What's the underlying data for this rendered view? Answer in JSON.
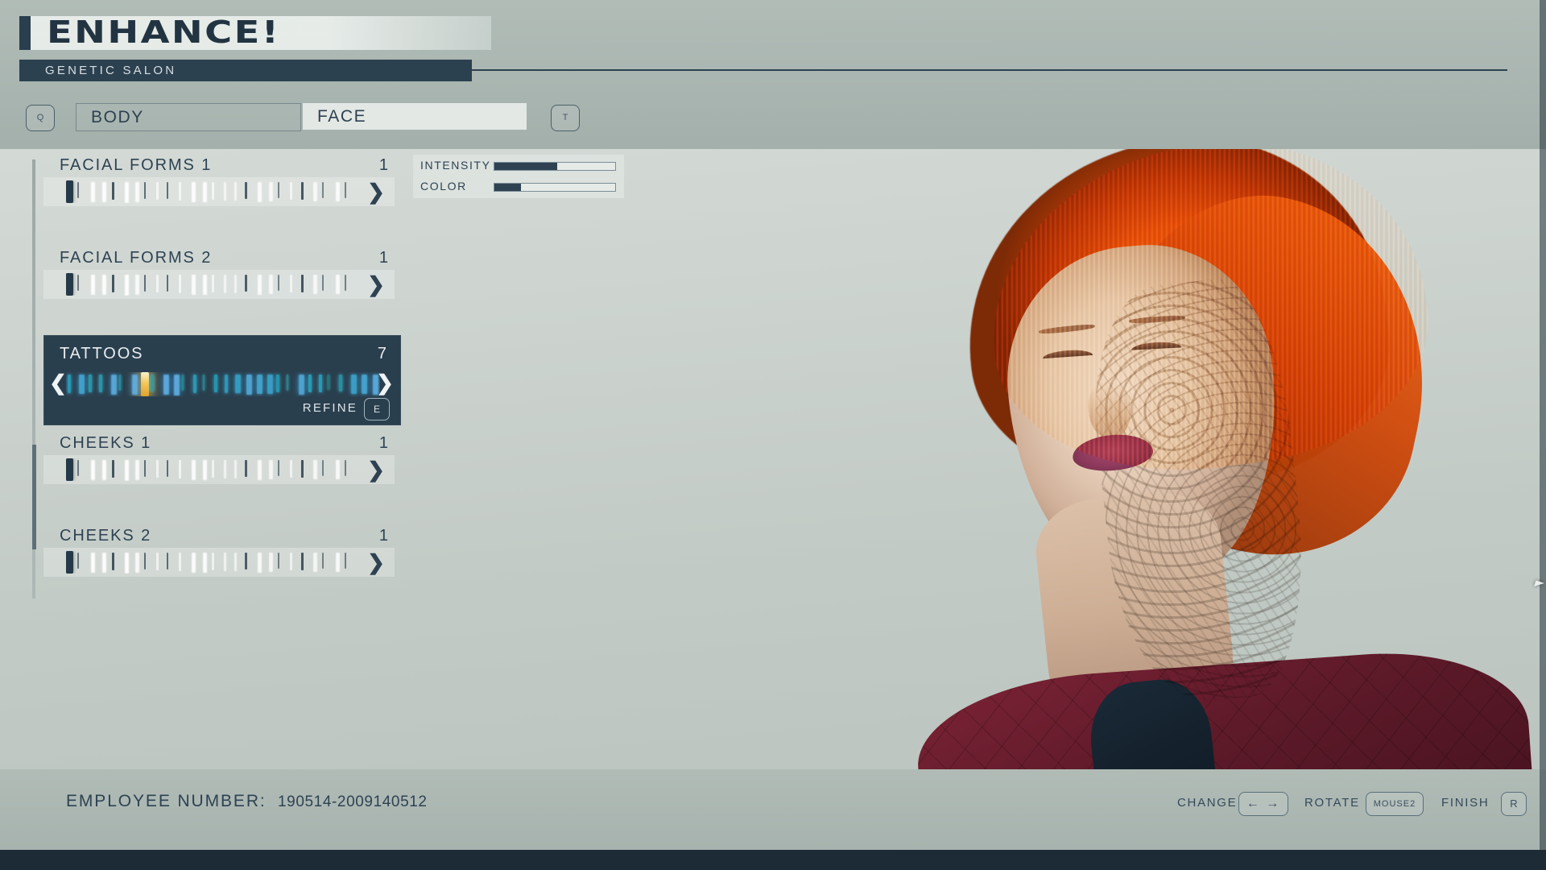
{
  "header": {
    "logo_text": "ENHANCE!",
    "subtitle": "GENETIC SALON",
    "key_left": "Q",
    "key_right": "T",
    "tabs": [
      {
        "label": "BODY",
        "selected": false
      },
      {
        "label": "FACE",
        "selected": true
      }
    ]
  },
  "options": [
    {
      "label": "FACIAL FORMS 1",
      "value": "1",
      "selected": false,
      "tick_count": 26,
      "selected_index": 0
    },
    {
      "label": "FACIAL FORMS 2",
      "value": "1",
      "selected": false,
      "tick_count": 26,
      "selected_index": 0
    },
    {
      "label": "TATTOOS",
      "value": "7",
      "selected": true,
      "tick_count": 30,
      "selected_index": 7,
      "refine_label": "REFINE",
      "refine_key": "E"
    },
    {
      "label": "CHEEKS 1",
      "value": "1",
      "selected": false,
      "tick_count": 26,
      "selected_index": 0
    },
    {
      "label": "CHEEKS 2",
      "value": "1",
      "selected": false,
      "tick_count": 26,
      "selected_index": 0
    }
  ],
  "sliders": [
    {
      "label": "INTENSITY",
      "fill_percent": 52
    },
    {
      "label": "COLOR",
      "fill_percent": 22
    }
  ],
  "footer": {
    "employee_label": "EMPLOYEE NUMBER:",
    "employee_value": "190514-2009140512",
    "controls": [
      {
        "label": "CHANGE",
        "key": "←  →"
      },
      {
        "label": "ROTATE",
        "key": "MOUSE2"
      },
      {
        "label": "FINISH",
        "key": "R"
      }
    ]
  },
  "colors": {
    "accent_dark": "#2a3f4e",
    "panel_light": "#b0bbb6",
    "selected_tick": "#f7c85b",
    "text_dark": "#2e4252",
    "text_light": "#e8edf0"
  }
}
